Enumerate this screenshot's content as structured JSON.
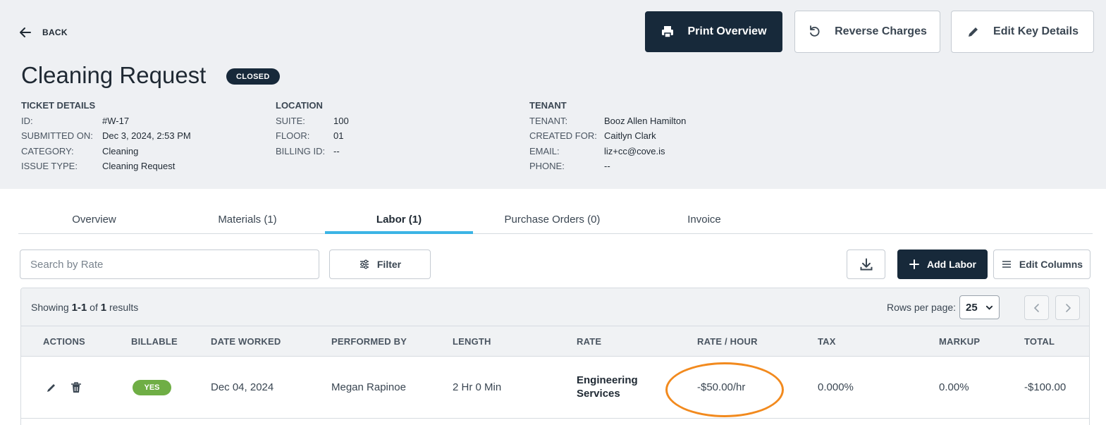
{
  "header": {
    "back_label": "BACK",
    "print_label": "Print Overview",
    "reverse_label": "Reverse Charges",
    "edit_label": "Edit Key Details",
    "title": "Cleaning Request",
    "status": "CLOSED"
  },
  "ticket": {
    "title": "TICKET DETAILS",
    "id_label": "ID:",
    "id": "#W-17",
    "submitted_label": "SUBMITTED ON:",
    "submitted": "Dec 3, 2024, 2:53 PM",
    "category_label": "CATEGORY:",
    "category": "Cleaning",
    "issue_label": "ISSUE TYPE:",
    "issue": "Cleaning Request"
  },
  "location": {
    "title": "LOCATION",
    "suite_label": "SUITE:",
    "suite": "100",
    "floor_label": "FLOOR:",
    "floor": "01",
    "billing_label": "BILLING ID:",
    "billing": "--"
  },
  "tenant": {
    "title": "TENANT",
    "tenant_label": "TENANT:",
    "tenant": "Booz Allen Hamilton",
    "created_label": "CREATED FOR:",
    "created": "Caitlyn Clark",
    "email_label": "EMAIL:",
    "email": "liz+cc@cove.is",
    "phone_label": "PHONE:",
    "phone": "--"
  },
  "tabs": [
    "Overview",
    "Materials (1)",
    "Labor (1)",
    "Purchase Orders (0)",
    "Invoice"
  ],
  "active_tab": "Labor (1)",
  "toolbar": {
    "search_placeholder": "Search by Rate",
    "filter_label": "Filter",
    "add_label": "Add Labor",
    "columns_label": "Edit Columns"
  },
  "table": {
    "showing_prefix": "Showing",
    "showing_range": "1-1",
    "showing_of": "of",
    "showing_total": "1",
    "showing_suffix": "results",
    "rows_per_page_label": "Rows per page:",
    "rows_per_page": "25",
    "columns": [
      "ACTIONS",
      "BILLABLE",
      "DATE WORKED",
      "PERFORMED BY",
      "LENGTH",
      "RATE",
      "RATE / HOUR",
      "TAX",
      "MARKUP",
      "TOTAL"
    ],
    "rows": [
      {
        "billable": "YES",
        "date": "Dec 04, 2024",
        "performed_by": "Megan Rapinoe",
        "length": "2 Hr 0 Min",
        "rate_line1": "Engineering",
        "rate_line2": "Services",
        "rate_hour": "-$50.00/hr",
        "tax": "0.000%",
        "markup": "0.00%",
        "total": "-$100.00"
      }
    ]
  },
  "colors": {
    "navy": "#17293a",
    "tab_accent": "#3bb4e5",
    "billable_green": "#6fae45",
    "highlight_orange": "#f28a1e",
    "header_bg": "#eef0f3"
  },
  "icons": [
    "arrow-left-icon",
    "printer-icon",
    "undo-icon",
    "pencil-icon",
    "sliders-icon",
    "download-icon",
    "plus-icon",
    "list-icon",
    "chevron-down-icon",
    "chevron-left-icon",
    "chevron-right-icon",
    "trash-icon"
  ]
}
